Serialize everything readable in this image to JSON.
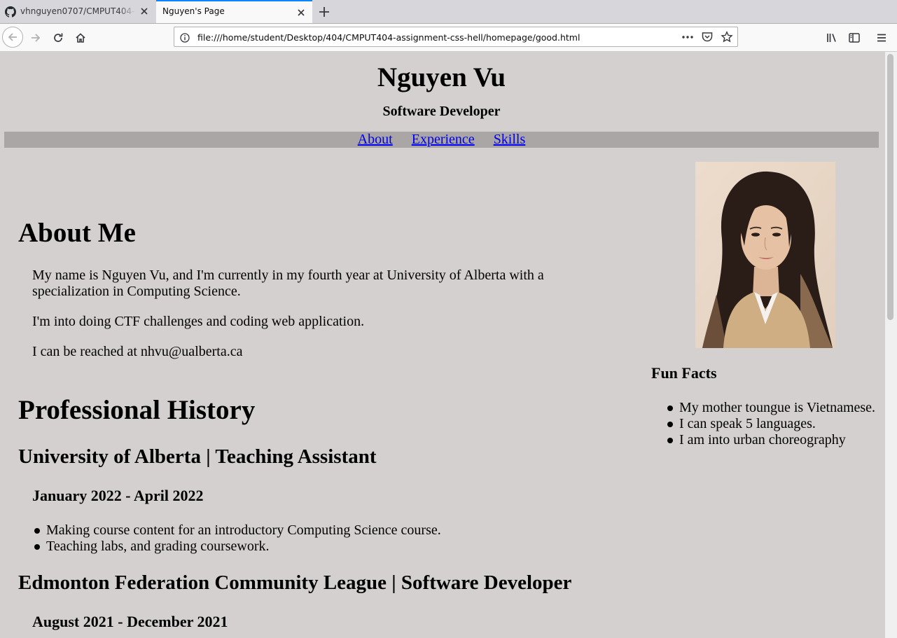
{
  "browser": {
    "tabs": [
      {
        "title": "vhnguyen0707/CMPUT404-assignment-css-hell",
        "icon": "github-icon",
        "active": false
      },
      {
        "title": "Nguyen's Page",
        "icon": "",
        "active": true
      }
    ],
    "url": "file:///home/student/Desktop/404/CMPUT404-assignment-css-hell/homepage/good.html"
  },
  "page": {
    "name": "Nguyen Vu",
    "role": "Software Developer",
    "nav": [
      "About",
      "Experience",
      "Skills"
    ],
    "about": {
      "heading": "About Me",
      "paragraphs": [
        "My name is Nguyen Vu, and I'm currently in my fourth year at University of Alberta with a specialization in Computing Science.",
        "I'm into doing CTF challenges and coding web application.",
        "I can be reached at nhvu@ualberta.ca"
      ]
    },
    "history": {
      "heading": "Professional History",
      "jobs": [
        {
          "title": "University of Alberta | Teaching Assistant",
          "dates": "January 2022 - April 2022",
          "bullets": [
            "Making course content for an introductory Computing Science course.",
            "Teaching labs, and grading coursework."
          ]
        },
        {
          "title": "Edmonton Federation Community League | Software Developer",
          "dates": "August 2021 - December 2021",
          "bullets": []
        }
      ]
    },
    "sidebar": {
      "funfacts_heading": "Fun Facts",
      "funfacts": [
        "My mother toungue is Vietnamese.",
        "I can speak 5 languages.",
        "I am into urban choreography"
      ]
    }
  },
  "colors": {
    "page_bg": "#d4d0cf",
    "nav_bg": "#aaa6a5",
    "link": "#0000ee",
    "tab_accent": "#0a84ff"
  }
}
